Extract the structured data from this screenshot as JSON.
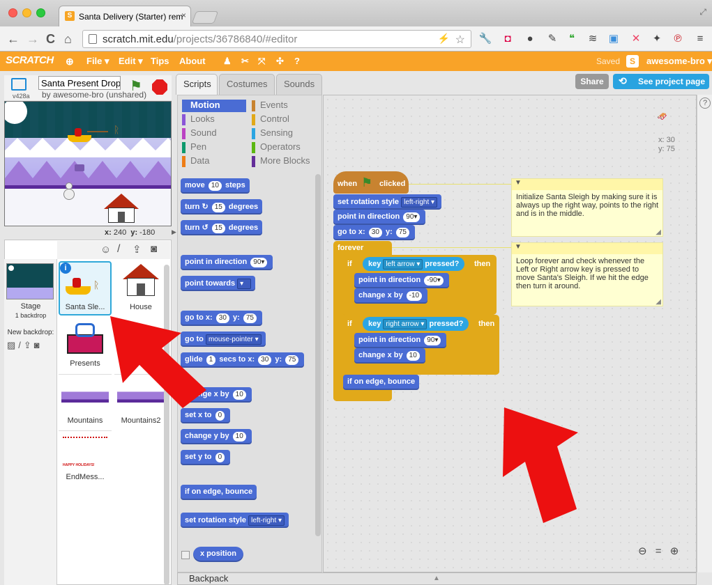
{
  "browser": {
    "tab_title": "Santa Delivery (Starter) rem",
    "tab_close": "×",
    "url_host": "scratch.mit.edu",
    "url_path": "/projects/36786840/#editor",
    "back": "←",
    "forward": "→",
    "reload": "C",
    "home": "⌂",
    "star": "☆"
  },
  "menubar": {
    "logo": "SCRATCH",
    "items": [
      "File ▾",
      "Edit ▾",
      "Tips",
      "About"
    ],
    "saved": "Saved",
    "username": "awesome-bro ▾"
  },
  "header_buttons": {
    "share": "Share",
    "see_project": "See project page"
  },
  "stage": {
    "version": "v428a",
    "project_title": "Santa Present Drop",
    "byline": "by awesome-bro (unshared)",
    "x_label": "x:",
    "x_value": "240",
    "y_label": "y:",
    "y_value": "-180"
  },
  "stage_thumb": {
    "label": "Stage",
    "sublabel": "1 backdrop",
    "new_backdrop": "New backdrop:"
  },
  "sprites": [
    {
      "label": "Santa Sle..."
    },
    {
      "label": "House"
    },
    {
      "label": "Presents"
    },
    {
      "label": "Mountains"
    },
    {
      "label": "Mountains2"
    },
    {
      "label": "EndMess..."
    }
  ],
  "end_message_text": "HAPPY HOLIDAYS!",
  "editor_tabs": [
    "Scripts",
    "Costumes",
    "Sounds"
  ],
  "categories": [
    {
      "label": "Motion",
      "color": "#4a6cd4"
    },
    {
      "label": "Events",
      "color": "#c88330"
    },
    {
      "label": "Looks",
      "color": "#8a55d7"
    },
    {
      "label": "Control",
      "color": "#e1a91a"
    },
    {
      "label": "Sound",
      "color": "#bb42c3"
    },
    {
      "label": "Sensing",
      "color": "#2ca5e2"
    },
    {
      "label": "Pen",
      "color": "#0e9a6c"
    },
    {
      "label": "Operators",
      "color": "#5cb712"
    },
    {
      "label": "Data",
      "color": "#ee7d16"
    },
    {
      "label": "More Blocks",
      "color": "#632d99"
    }
  ],
  "palette": {
    "move": "move",
    "move_val": "10",
    "steps": "steps",
    "turn": "turn",
    "turn_cw": "↻",
    "turn_ccw": "↺",
    "turn_val": "15",
    "degrees": "degrees",
    "point_dir": "point in direction",
    "dir_val": "90▾",
    "point_towards": "point towards",
    "towards_dd": "▾",
    "goto_xy": "go to x:",
    "x_val": "30",
    "y_lbl": "y:",
    "y_val": "75",
    "goto": "go to",
    "goto_dd": "mouse-pointer ▾",
    "glide": "glide",
    "glide_val": "1",
    "glide_secs": "secs to x:",
    "change_x": "change x by",
    "cx_val": "10",
    "set_x": "set x to",
    "sx_val": "0",
    "change_y": "change y by",
    "cy_val": "10",
    "set_y": "set y to",
    "sy_val": "0",
    "bounce": "if on edge, bounce",
    "rotation": "set rotation style",
    "rotation_dd": "left-right ▾",
    "x_position": "x position"
  },
  "script": {
    "when": "when",
    "clicked": "clicked",
    "rotation": "set rotation style",
    "rotation_dd": "left-right ▾",
    "point_dir": "point in direction",
    "dir_90": "90▾",
    "goto": "go to x:",
    "x": "30",
    "y_lbl": "y:",
    "y": "75",
    "forever": "forever",
    "if": "if",
    "then": "then",
    "key": "key",
    "left_key": "left arrow ▾",
    "right_key": "right arrow ▾",
    "pressed": "pressed?",
    "dir_neg90": "-90▾",
    "change_x": "change x by",
    "neg10": "-10",
    "pos10": "10",
    "bounce": "if on edge, bounce"
  },
  "sprite_info": {
    "x": "x: 30",
    "y": "y: 75"
  },
  "comments": [
    "Initialize Santa Sleigh by making sure it is always up the right way, points to the right and is in the middle.",
    "Loop forever and check whenever the Left or Right arrow key is pressed to move Santa's Sleigh. If we hit the edge then turn it around."
  ],
  "backpack": "Backpack",
  "help": "?",
  "zoom": {
    "out": "⊖",
    "reset": "=",
    "in": "⊕"
  }
}
